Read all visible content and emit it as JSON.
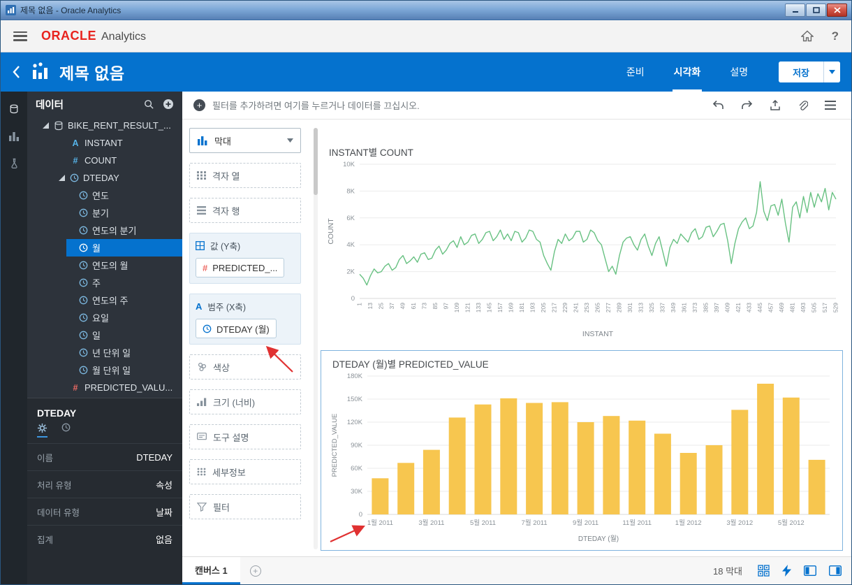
{
  "window": {
    "title": "제목 없음 - Oracle Analytics"
  },
  "app_header": {
    "brand": "ORACLE",
    "product": "Analytics"
  },
  "project_header": {
    "title": "제목 없음",
    "tabs": [
      {
        "label": "준비",
        "active": false
      },
      {
        "label": "시각화",
        "active": true
      },
      {
        "label": "설명",
        "active": false
      }
    ],
    "save_label": "저장"
  },
  "left_rail": {
    "icons": [
      "data",
      "visualize",
      "advanced"
    ]
  },
  "data_panel": {
    "title": "데이터",
    "dataset": {
      "label": "BIKE_RENT_RESULT_..."
    },
    "fields": [
      {
        "label": "INSTANT",
        "type": "text"
      },
      {
        "label": "COUNT",
        "type": "measure-blue"
      },
      {
        "label": "DTEDAY",
        "type": "time",
        "expanded": true,
        "selected": "월",
        "children": [
          "연도",
          "분기",
          "연도의 분기",
          "월",
          "연도의 월",
          "주",
          "연도의 주",
          "요일",
          "일",
          "년 단위 일",
          "월 단위 일"
        ]
      },
      {
        "label": "PREDICTED_VALU...",
        "type": "measure-red"
      }
    ]
  },
  "properties_panel": {
    "title": "DTEDAY",
    "tabs": [
      {
        "icon": "gear",
        "active": true
      },
      {
        "icon": "clock",
        "active": false
      }
    ],
    "rows": [
      {
        "label": "이름",
        "value": "DTEDAY"
      },
      {
        "label": "처리 유형",
        "value": "속성"
      },
      {
        "label": "데이터 유형",
        "value": "날짜"
      },
      {
        "label": "집계",
        "value": "없음"
      }
    ]
  },
  "filter_bar": {
    "prompt": "필터를 추가하려면 여기를 누르거나 데이터를 끄십시오.",
    "tools": [
      "undo",
      "redo",
      "export",
      "attach",
      "menu"
    ]
  },
  "grammar_panel": {
    "chart_type": {
      "label": "막대"
    },
    "zones": [
      {
        "key": "grid-columns",
        "label": "격자 열",
        "icon": "grid-cols",
        "style": "dashed"
      },
      {
        "key": "grid-rows",
        "label": "격자 행",
        "icon": "grid-rows",
        "style": "dashed"
      },
      {
        "key": "values-y-axis",
        "label": "값 (Y축)",
        "icon": "values",
        "style": "section",
        "chips": [
          {
            "key": "predicted-value",
            "label": "PREDICTED_...",
            "icon": "hash-red"
          }
        ]
      },
      {
        "key": "category-x-axis",
        "label": "범주 (X축)",
        "icon": "category",
        "style": "section",
        "chips": [
          {
            "key": "dteday-month",
            "label": "DTEDAY (월)",
            "icon": "clock"
          }
        ]
      },
      {
        "key": "color",
        "label": "색상",
        "icon": "color",
        "style": "dashed"
      },
      {
        "key": "size",
        "label": "크기 (너비)",
        "icon": "size",
        "style": "dashed"
      },
      {
        "key": "tooltip",
        "label": "도구 설명",
        "icon": "tooltip",
        "style": "dashed"
      },
      {
        "key": "detail",
        "label": "세부정보",
        "icon": "detail",
        "style": "dashed"
      },
      {
        "key": "filter",
        "label": "필터",
        "icon": "filter",
        "style": "dashed"
      }
    ]
  },
  "status_bar": {
    "canvas_tab": "캔버스 1",
    "status": "18 막대",
    "tools": [
      "matrix",
      "lightning",
      "panel-left",
      "panel-right"
    ]
  },
  "chart_data": [
    {
      "type": "line",
      "title": "INSTANT별 COUNT",
      "xlabel": "INSTANT",
      "ylabel": "COUNT",
      "color": "#68C182",
      "xlim": [
        1,
        529
      ],
      "ylim": [
        0,
        10000
      ],
      "yticks": [
        0,
        2000,
        4000,
        6000,
        8000,
        10000
      ],
      "ytick_labels": [
        "0",
        "2K",
        "4K",
        "6K",
        "8K",
        "10K"
      ],
      "xticks": [
        1,
        13,
        25,
        37,
        49,
        61,
        73,
        85,
        97,
        109,
        121,
        133,
        145,
        157,
        169,
        181,
        193,
        205,
        217,
        229,
        241,
        253,
        265,
        277,
        289,
        301,
        313,
        325,
        337,
        349,
        361,
        373,
        385,
        397,
        409,
        421,
        433,
        445,
        457,
        469,
        481,
        493,
        505,
        517,
        529
      ],
      "x_start": 1,
      "x_step": 4,
      "values": [
        1800,
        1500,
        1000,
        1700,
        2200,
        1900,
        2000,
        2400,
        2600,
        2100,
        2300,
        2900,
        3200,
        2600,
        2800,
        3100,
        2700,
        3300,
        3400,
        2900,
        3000,
        3600,
        3900,
        3300,
        3600,
        4100,
        4300,
        3800,
        4600,
        4000,
        4200,
        4700,
        4800,
        4100,
        4400,
        4900,
        5000,
        4300,
        4600,
        5100,
        4400,
        4800,
        4300,
        5000,
        4900,
        4200,
        4500,
        5100,
        5000,
        4400,
        4200,
        3200,
        2600,
        2100,
        3500,
        4400,
        4100,
        4800,
        4300,
        4500,
        5000,
        5000,
        4200,
        4400,
        5100,
        4900,
        4300,
        4000,
        3000,
        2000,
        2400,
        1800,
        3200,
        4200,
        4500,
        4600,
        4000,
        3600,
        4400,
        4800,
        3900,
        3200,
        4100,
        4600,
        3500,
        2400,
        3800,
        4400,
        4100,
        4800,
        4500,
        4200,
        4900,
        5200,
        4400,
        4600,
        5300,
        5400,
        4600,
        5000,
        5500,
        5600,
        4300,
        2600,
        4100,
        5200,
        5700,
        6000,
        5200,
        5400,
        6400,
        8700,
        6500,
        5800,
        6900,
        7000,
        6200,
        7400,
        5600,
        4200,
        6800,
        7200,
        6000,
        7600,
        6400,
        7900,
        6800,
        7800,
        7200,
        8200,
        6600,
        7900,
        7400
      ]
    },
    {
      "type": "bar",
      "title": "DTEDAY (월)별 PREDICTED_VALUE",
      "xlabel": "DTEDAY (월)",
      "ylabel": "PREDICTED_VALUE",
      "color": "#F7C64F",
      "ylim": [
        0,
        180000
      ],
      "yticks": [
        0,
        30000,
        60000,
        90000,
        120000,
        150000,
        180000
      ],
      "ytick_labels": [
        "0",
        "30K",
        "60K",
        "90K",
        "120K",
        "150K",
        "180K"
      ],
      "categories": [
        "1월 2011",
        "2월 2011",
        "3월 2011",
        "4월 2011",
        "5월 2011",
        "6월 2011",
        "7월 2011",
        "8월 2011",
        "9월 2011",
        "10월 2011",
        "11월 2011",
        "12월 2011",
        "1월 2012",
        "2월 2012",
        "3월 2012",
        "4월 2012",
        "5월 2012",
        "6월 2012"
      ],
      "values": [
        47000,
        67000,
        84000,
        126000,
        143000,
        151000,
        145000,
        146000,
        120000,
        128000,
        122000,
        105000,
        80000,
        90000,
        136000,
        170000,
        152000,
        71000
      ],
      "label_every": 2
    }
  ]
}
